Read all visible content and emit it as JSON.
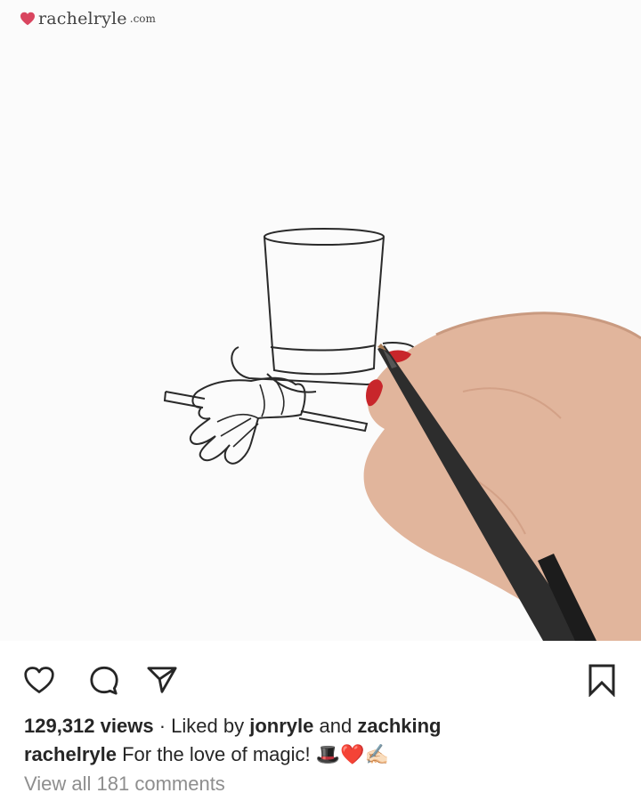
{
  "watermark": {
    "brand": "rachelryle",
    "tld": ".com"
  },
  "post": {
    "views_count": "129,312 views",
    "separator": "·",
    "liked_by_prefix": "Liked by",
    "liked_user_1": "jonryle",
    "liked_joiner": "and",
    "liked_user_2": "zachking",
    "author": "rachelryle",
    "caption": "For the love of magic!",
    "caption_emojis": "🎩❤️✍🏻",
    "comments_link": "View all 181 comments"
  },
  "icons": {
    "like": "heart-outline-icon",
    "comment": "comment-bubble-icon",
    "share": "paper-plane-icon",
    "save": "bookmark-outline-icon"
  },
  "colors": {
    "text": "#262626",
    "muted": "#8e8e8e",
    "watermark_heart": "#d9455f",
    "nail_polish": "#c8262b"
  }
}
